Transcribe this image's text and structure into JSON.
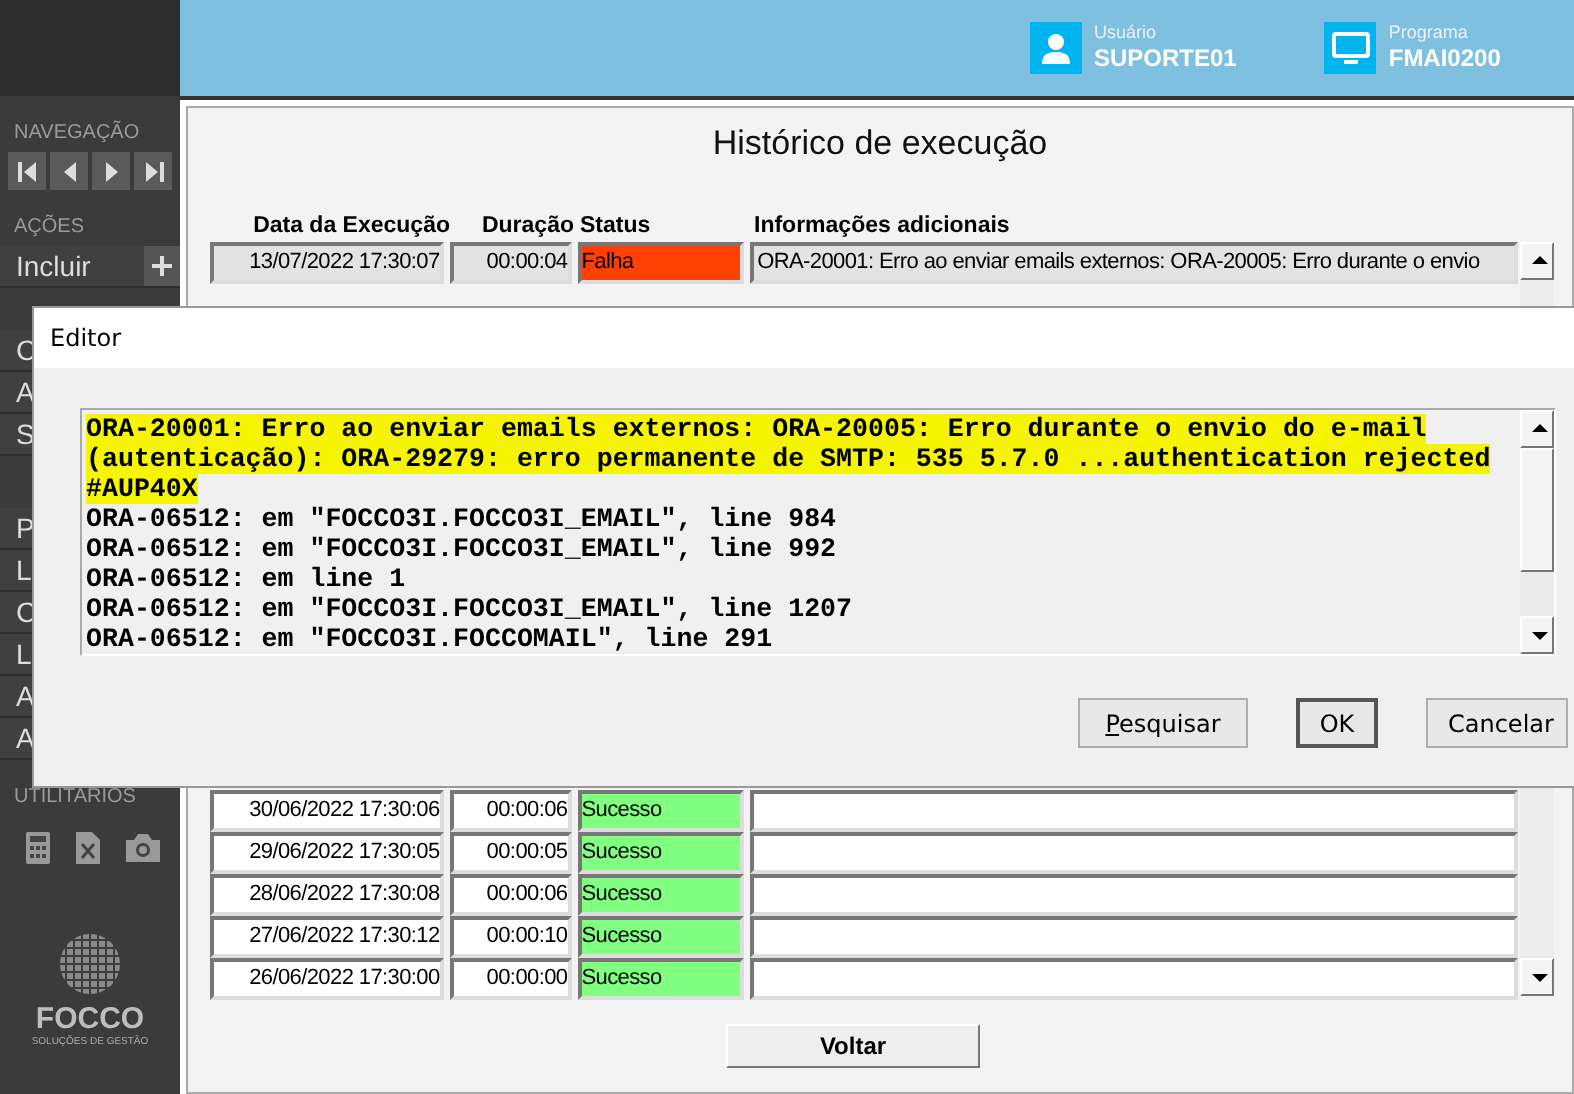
{
  "header": {
    "user": {
      "label": "Usuário",
      "value": "SUPORTE01"
    },
    "program": {
      "label": "Programa",
      "value": "FMAI0200"
    }
  },
  "sidebar": {
    "sections": [
      {
        "title": "NAVEGAÇÃO",
        "kind": "nav"
      },
      {
        "title": "AÇÕES",
        "kind": "items",
        "items": [
          {
            "label": "Incluir",
            "kind": "add"
          },
          {
            "label": "C",
            "kind": "plain"
          },
          {
            "label": "A",
            "kind": "plain"
          },
          {
            "label": "S",
            "kind": "plain"
          }
        ]
      },
      {
        "kind": "items",
        "items": [
          {
            "label": "P",
            "kind": "plain"
          },
          {
            "label": "L",
            "kind": "plain"
          },
          {
            "label": "C",
            "kind": "plain"
          },
          {
            "label": "L",
            "kind": "plain"
          },
          {
            "label": "A",
            "kind": "plain"
          },
          {
            "label": "A",
            "kind": "plain"
          }
        ]
      },
      {
        "title": "UTILITARIOS",
        "kind": "tools"
      }
    ],
    "logo": {
      "name": "FOCCO",
      "tagline": "SOLUÇÕES DE GESTÃO"
    }
  },
  "main": {
    "title": "Histórico de execução",
    "table": {
      "columns": [
        "Data da Execução",
        "Duração",
        "Status",
        "Informações adicionais"
      ],
      "rows_above_editor": [
        {
          "date": "13/07/2022 17:30:07",
          "duration": "00:00:04",
          "status": "Falha",
          "color": "#ff4000",
          "info": "ORA-20001: Erro ao enviar emails externos: ORA-20005: Erro durante o envio",
          "selected": true
        }
      ],
      "rows_below_editor": [
        {
          "date": "30/06/2022 17:30:06",
          "duration": "00:00:06",
          "status": "Sucesso",
          "color": "#80ff80",
          "selected": false
        },
        {
          "date": "29/06/2022 17:30:05",
          "duration": "00:00:05",
          "status": "Sucesso",
          "color": "#80ff80",
          "selected": false
        },
        {
          "date": "28/06/2022 17:30:08",
          "duration": "00:00:06",
          "status": "Sucesso",
          "color": "#80ff80",
          "selected": false
        },
        {
          "date": "27/06/2022 17:30:12",
          "duration": "00:00:10",
          "status": "Sucesso",
          "color": "#80ff80",
          "selected": false
        },
        {
          "date": "26/06/2022 17:30:00",
          "duration": "00:00:00",
          "status": "Sucesso",
          "color": "#80ff80",
          "selected": false
        }
      ]
    },
    "back_button": "Voltar"
  },
  "editor": {
    "title": "Editor",
    "lines": [
      {
        "text": "ORA-20001: Erro ao enviar emails externos: ORA-20005: Erro durante o envio do e-mail",
        "selected": true
      },
      {
        "text": "(autenticação): ORA-29279: erro permanente de SMTP: 535 5.7.0 ...authentication rejected",
        "selected": true
      },
      {
        "text": "#AUP40X",
        "selected": true
      },
      {
        "text": "ORA-06512: em \"FOCCO3I.FOCCO3I_EMAIL\", line 984",
        "selected": false
      },
      {
        "text": "ORA-06512: em \"FOCCO3I.FOCCO3I_EMAIL\", line 992",
        "selected": false
      },
      {
        "text": "ORA-06512: em line 1",
        "selected": false
      },
      {
        "text": "ORA-06512: em \"FOCCO3I.FOCCO3I_EMAIL\", line 1207",
        "selected": false
      },
      {
        "text": "ORA-06512: em \"FOCCO3I.FOCCOMAIL\", line 291",
        "selected": false
      }
    ],
    "buttons": [
      {
        "label": "Pesquisar",
        "kind": "mnemonic"
      },
      {
        "label": "OK",
        "kind": "default"
      },
      {
        "label": "Cancelar",
        "kind": "plain"
      }
    ]
  }
}
